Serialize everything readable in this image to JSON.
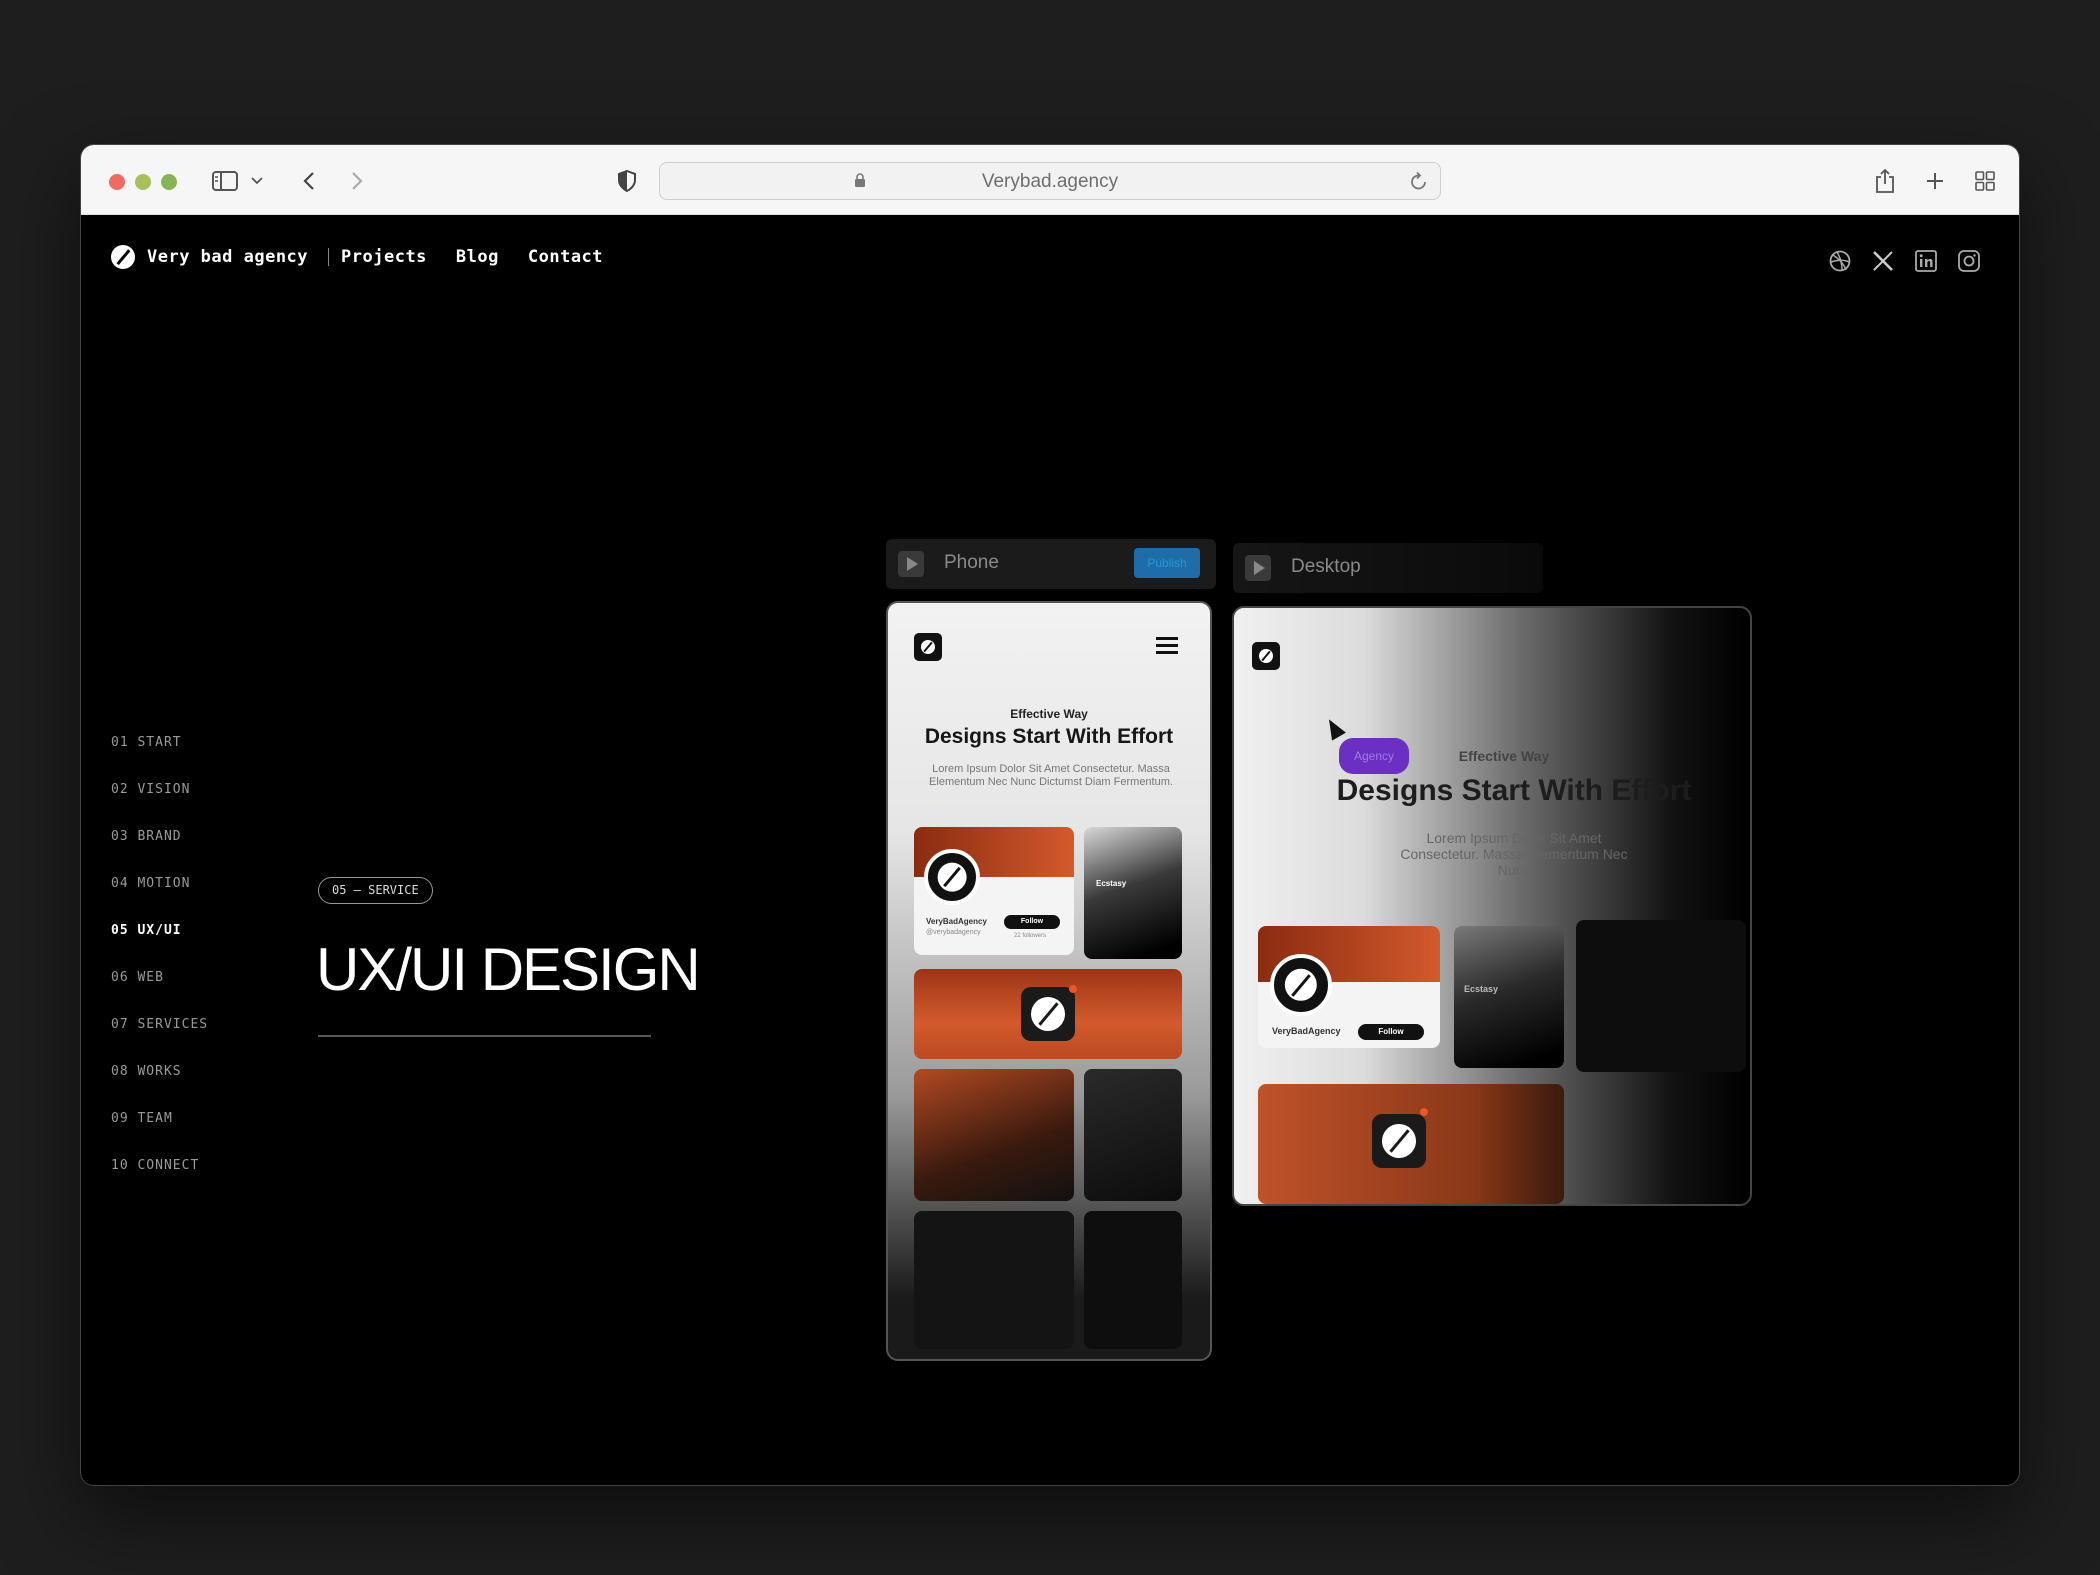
{
  "browser": {
    "url": "Verybad.agency"
  },
  "nav": {
    "brand": "Very bad agency",
    "links": [
      "Projects",
      "Blog",
      "Contact"
    ],
    "socials": [
      "dribbble-icon",
      "x-icon",
      "linkedin-icon",
      "instagram-icon"
    ]
  },
  "sidenav": [
    "01 START",
    "02 VISION",
    "03 BRAND",
    "04 MOTION",
    "05 UX/UI",
    "06 WEB",
    "07 SERVICES",
    "08 WORKS",
    "09 TEAM",
    "10 CONNECT"
  ],
  "active_section": "05 UX/UI",
  "section": {
    "badge": "05 — SERVICE",
    "title": "UX/UI DESIGN"
  },
  "mockups": {
    "phone_tab": "Phone",
    "phone_action": "Publish",
    "desktop_tab": "Desktop",
    "eyebrow": "Effective Way",
    "hero": "Designs Start With Effort",
    "lorem": "Lorem Ipsum Dolor Sit Amet Consectetur. Massa Elementum Nec Nunc Dictumst Diam Fermentum.",
    "profile_name": "VeryBadAgency",
    "profile_handle": "@verybadagency",
    "follow": "Follow",
    "followers": "22 followers",
    "ecstasy": "Ecstasy",
    "agency_pill": "Agency",
    "desktop_eyebrow": "Effective Way",
    "desktop_hero": "Designs Start With Effort",
    "desktop_lorem": "Lorem Ipsum Dolor Sit Amet Consectetur. Massa Elementum Nec Nunc",
    "accent_color": "#d35a2c",
    "purple": "#6b2fc4"
  }
}
